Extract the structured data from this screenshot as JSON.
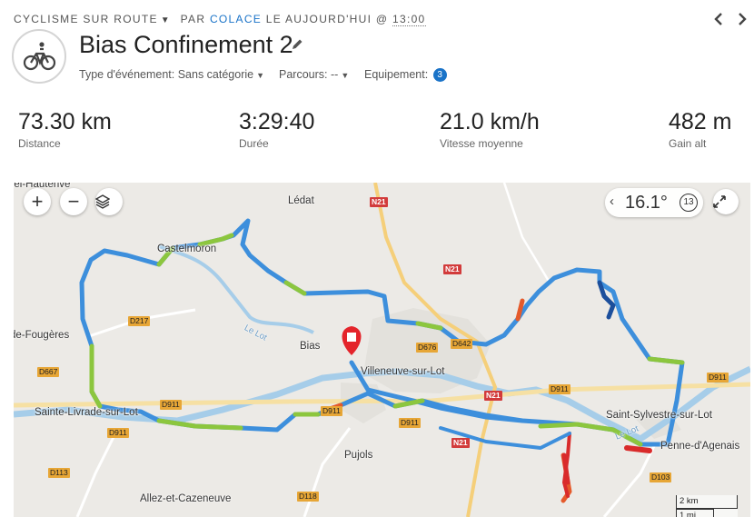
{
  "header": {
    "activity_type": "CYCLISME SUR ROUTE",
    "by_label": "PAR",
    "author": "COLACE",
    "date_label": "LE AUJOURD'HUI @",
    "time": "13:00",
    "title": "Bias Confinement 2",
    "event_type_label": "Type d'événement:",
    "event_type_value": "Sans catégorie",
    "course_label": "Parcours:",
    "course_value": "--",
    "equipment_label": "Equipement:",
    "equipment_count": "3"
  },
  "stats": [
    {
      "value": "73.30 km",
      "label": "Distance"
    },
    {
      "value": "3:29:40",
      "label": "Durée"
    },
    {
      "value": "21.0 km/h",
      "label": "Vitesse moyenne"
    },
    {
      "value": "482 m",
      "label": "Gain alt"
    }
  ],
  "map": {
    "temperature": "16.1°",
    "wind": "13",
    "places": {
      "castelmoron": "Castelmoron",
      "ledat": "Lédat",
      "fougeres": "de-Fougères",
      "bias": "Bias",
      "villeneuve": "Villeneuve-sur-Lot",
      "sainte_livrade": "Sainte-Livrade-sur-Lot",
      "pujols": "Pujols",
      "allez": "Allez-et-Cazeneuve",
      "saint_sylvestre": "Saint-Sylvestre-sur-Lot",
      "penne": "Penne-d'Agenais",
      "hauterive": "del-Hauterive",
      "le_lot_1": "Le Lot",
      "le_lot_2": "Le Lot"
    },
    "roads": {
      "n21a": "N21",
      "n21b": "N21",
      "n21c": "N21",
      "n21d": "N21",
      "d217": "D217",
      "d667": "D667",
      "d911a": "D911",
      "d911b": "D911",
      "d911c": "D911",
      "d911d": "D911",
      "d911e": "D911",
      "d911f": "D911",
      "d676": "D676",
      "d642": "D642",
      "d113": "D113",
      "d118": "D118",
      "d103": "D103"
    },
    "scale_km": "2 km",
    "scale_mi": "1 mi"
  },
  "colors": {
    "accent": "#1a73c8",
    "route_blue": "#3d8fdc",
    "route_green": "#8cc63e",
    "route_red": "#d92b2b"
  }
}
